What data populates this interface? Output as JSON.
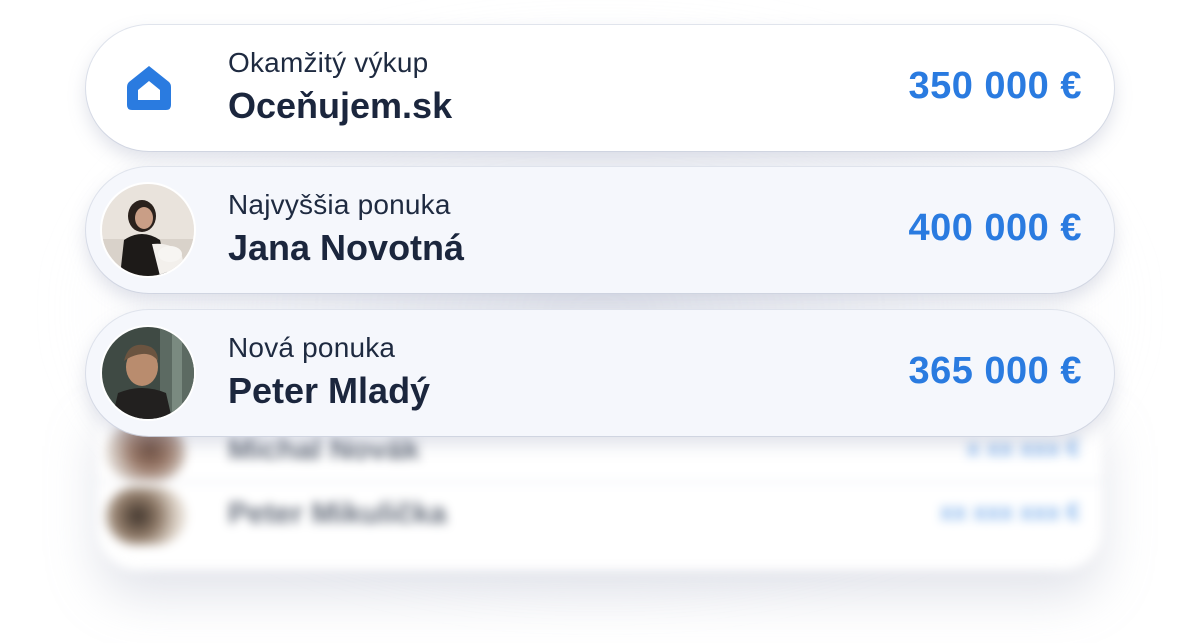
{
  "offers": [
    {
      "subtitle": "Okamžitý výkup",
      "name": "Oceňujem.sk",
      "price": "350 000 €",
      "icon": "house-icon"
    },
    {
      "subtitle": "Najvyššia ponuka",
      "name": "Jana Novotná",
      "price": "400 000 €",
      "icon": "avatar"
    },
    {
      "subtitle": "Nová ponuka",
      "name": "Peter Mladý",
      "price": "365 000 €",
      "icon": "avatar"
    }
  ],
  "blurred_offers": [
    {
      "name": "Michal Novák",
      "price": "x xx xxx €"
    },
    {
      "name": "Peter Mikulička",
      "price": "xx xxx xxx €"
    }
  ],
  "colors": {
    "accent": "#2a7be0",
    "text_dark": "#1b263d",
    "card_bg": "#f5f7fc"
  }
}
